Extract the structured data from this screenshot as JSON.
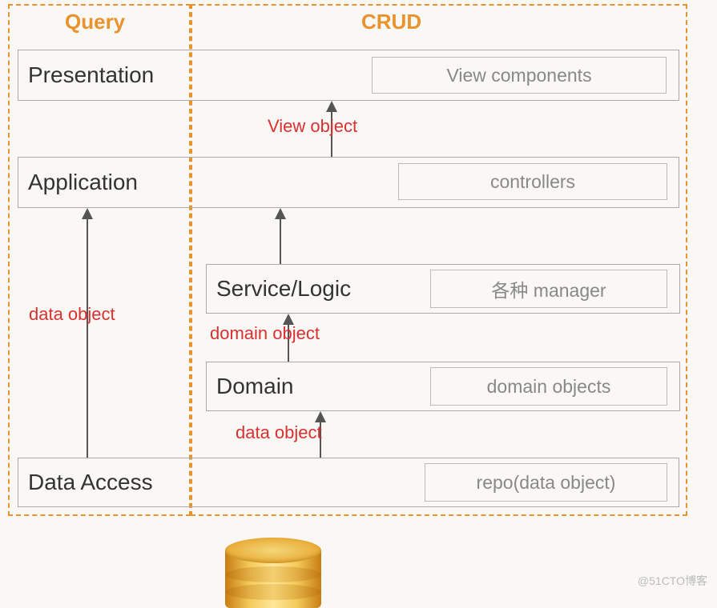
{
  "sections": {
    "query_title": "Query",
    "crud_title": "CRUD"
  },
  "layers": {
    "presentation": {
      "name": "Presentation",
      "component": "View components"
    },
    "application": {
      "name": "Application",
      "component": "controllers"
    },
    "service": {
      "name": "Service/Logic",
      "component": "各种 manager"
    },
    "domain": {
      "name": "Domain",
      "component": "domain objects"
    },
    "data_access": {
      "name": "Data Access",
      "component": "repo(data object)"
    }
  },
  "flows": {
    "view_object": "View object",
    "data_object_left": "data object",
    "domain_object": "domain object",
    "data_object_right": "data object"
  },
  "watermark": "@51CTO博客"
}
